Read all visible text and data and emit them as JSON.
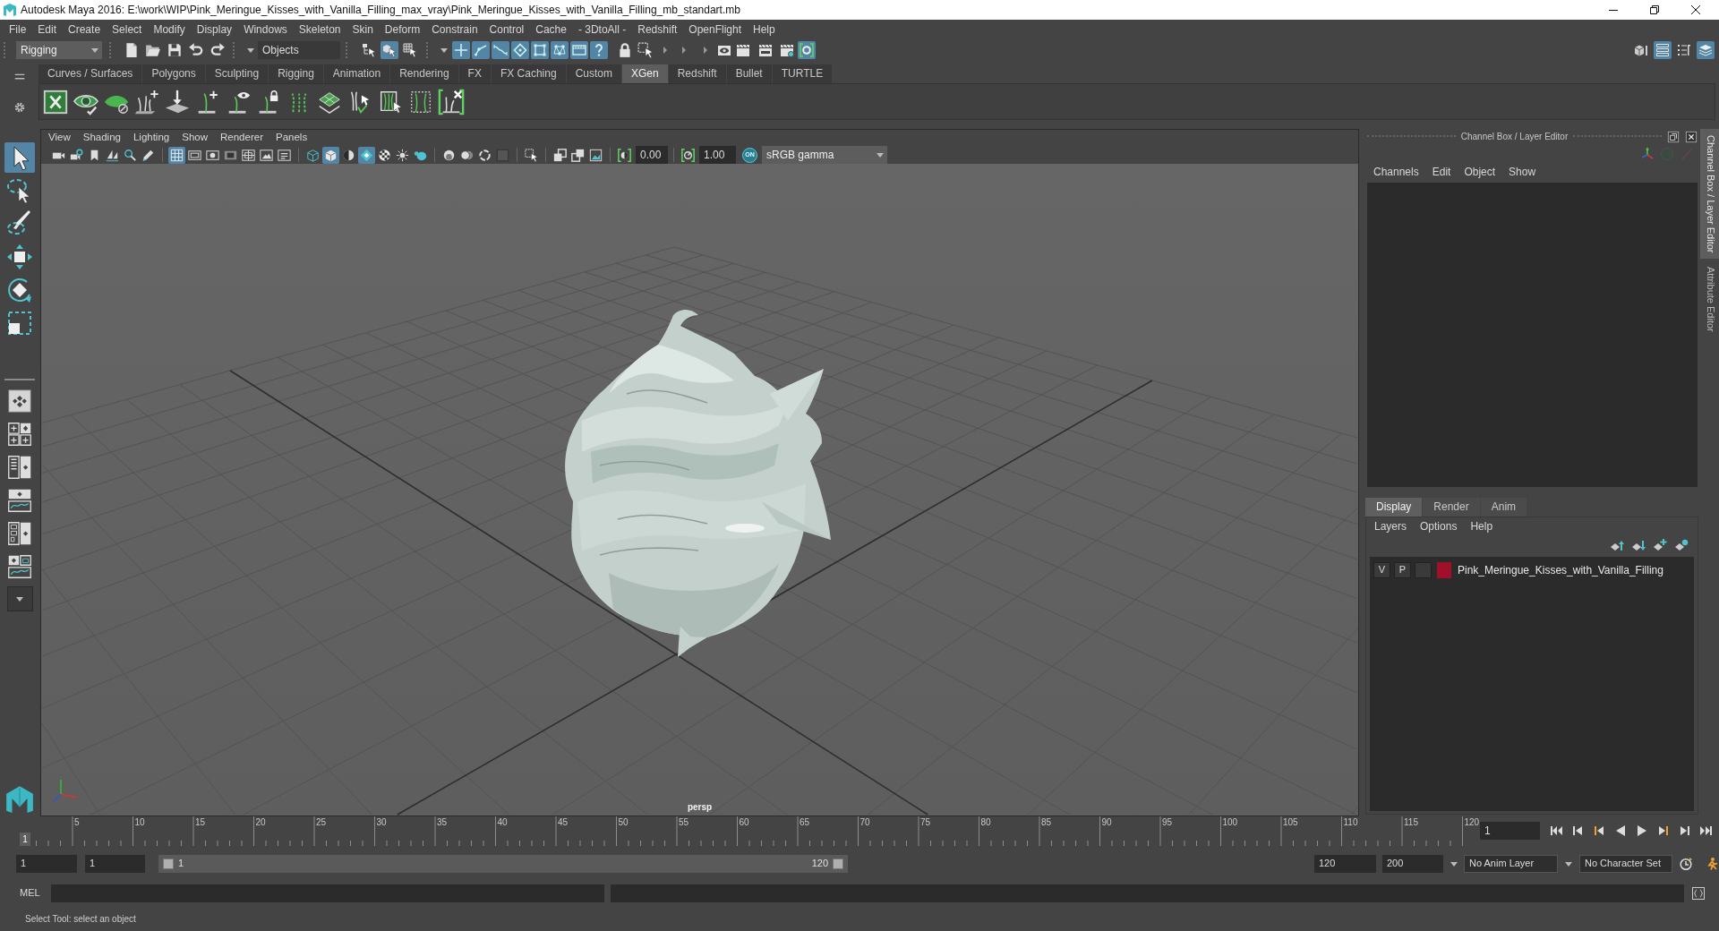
{
  "window": {
    "title": "Autodesk Maya 2016: E:\\work\\WIP\\Pink_Meringue_Kisses_with_Vanilla_Filling_max_vray\\Pink_Meringue_Kisses_with_Vanilla_Filling_mb_standart.mb"
  },
  "menu_bar": [
    "File",
    "Edit",
    "Create",
    "Select",
    "Modify",
    "Display",
    "Windows",
    "Skeleton",
    "Skin",
    "Deform",
    "Constrain",
    "Control",
    "Cache",
    "- 3DtoAll -",
    "Redshift",
    "OpenFlight",
    "Help"
  ],
  "status_line": {
    "menu_set": "Rigging",
    "selection_field": "Objects",
    "select_modes": [
      {
        "selected": false
      },
      {
        "selected": true
      },
      {
        "selected": false
      }
    ],
    "mask_buttons": [
      {
        "on": true
      },
      {
        "on": true
      },
      {
        "on": true
      },
      {
        "on": true
      },
      {
        "on": true
      },
      {
        "on": true
      },
      {
        "on": true
      },
      {
        "on": true
      }
    ],
    "render_buttons": [
      {
        "on": false
      },
      {
        "on": false
      },
      {
        "on": false
      },
      {
        "on": false
      },
      {
        "on": true
      }
    ],
    "panel_toggles": [
      {
        "on": false
      },
      {
        "on": true
      },
      {
        "on": false
      },
      {
        "on": true
      }
    ]
  },
  "shelf": {
    "tabs": [
      {
        "label": "Curves / Surfaces",
        "selected": false
      },
      {
        "label": "Polygons",
        "selected": false
      },
      {
        "label": "Sculpting",
        "selected": false
      },
      {
        "label": "Rigging",
        "selected": false
      },
      {
        "label": "Animation",
        "selected": false
      },
      {
        "label": "Rendering",
        "selected": false
      },
      {
        "label": "FX",
        "selected": false
      },
      {
        "label": "FX Caching",
        "selected": false
      },
      {
        "label": "Custom",
        "selected": false
      },
      {
        "label": "XGen",
        "selected": true
      },
      {
        "label": "Redshift",
        "selected": false
      },
      {
        "label": "Bullet",
        "selected": false
      },
      {
        "label": "TURTLE",
        "selected": false
      }
    ]
  },
  "tool_box": {
    "tools": [
      {
        "selected": true
      },
      {
        "selected": false
      },
      {
        "selected": false
      },
      {
        "selected": false
      },
      {
        "selected": false
      },
      {
        "selected": false
      }
    ]
  },
  "viewport": {
    "menu": [
      "View",
      "Shading",
      "Lighting",
      "Show",
      "Renderer",
      "Panels"
    ],
    "toolbar": {
      "buttons": [
        {
          "on": false
        },
        {
          "on": false
        },
        {
          "on": false
        },
        {
          "on": false
        },
        {
          "on": false
        },
        {
          "on": false
        },
        {
          "on": true
        },
        {
          "on": false
        },
        {
          "on": false
        },
        {
          "on": false
        },
        {
          "on": false
        },
        {
          "on": false
        },
        {
          "on": false
        },
        {
          "on": false
        },
        {
          "on": true
        },
        {
          "on": false
        },
        {
          "on": true
        },
        {
          "on": false
        },
        {
          "on": false
        },
        {
          "on": false
        },
        {
          "on": false
        },
        {
          "on": false
        },
        {
          "on": false
        },
        {
          "on": false
        },
        {
          "on": false
        },
        {
          "on": false
        },
        {
          "on": false
        },
        {
          "on": false
        },
        {
          "on": false
        },
        {
          "on": false
        }
      ],
      "exposure": "0.00",
      "gamma": "1.00",
      "color_management": "ON",
      "color_space": "sRGB gamma"
    },
    "camera_label": "persp"
  },
  "channel_box": {
    "title": "Channel Box / Layer Editor",
    "menu": [
      "Channels",
      "Edit",
      "Object",
      "Show"
    ],
    "layer_tabs": [
      {
        "label": "Display",
        "selected": true
      },
      {
        "label": "Render",
        "selected": false
      },
      {
        "label": "Anim",
        "selected": false
      }
    ],
    "layer_menu": [
      "Layers",
      "Options",
      "Help"
    ],
    "layers": [
      {
        "visibility": "V",
        "playback": "P",
        "color": "#a0102a",
        "name": "Pink_Meringue_Kisses_with_Vanilla_Filling"
      }
    ]
  },
  "side_tabs": [
    {
      "label": "Channel Box / Layer Editor",
      "selected": true
    },
    {
      "label": "Attribute Editor",
      "selected": false
    }
  ],
  "time_slider": {
    "frame_labels": [
      "5",
      "10",
      "15",
      "20",
      "25",
      "30",
      "35",
      "40",
      "45",
      "50",
      "55",
      "60",
      "65",
      "70",
      "75",
      "80",
      "85",
      "90",
      "95",
      "100",
      "105",
      "110",
      "115",
      "120"
    ],
    "current_marker": "1",
    "level": 0,
    "current_frame": "1"
  },
  "range_slider": {
    "animation_start": "1",
    "playback_start": "1",
    "slider_start": "1",
    "slider_end": "120",
    "playback_end": "120",
    "animation_end": "200",
    "anim_layer": "No Anim Layer",
    "character_set": "No Character Set"
  },
  "command_line": {
    "language": "MEL"
  },
  "help_line": "Select Tool: select an object"
}
